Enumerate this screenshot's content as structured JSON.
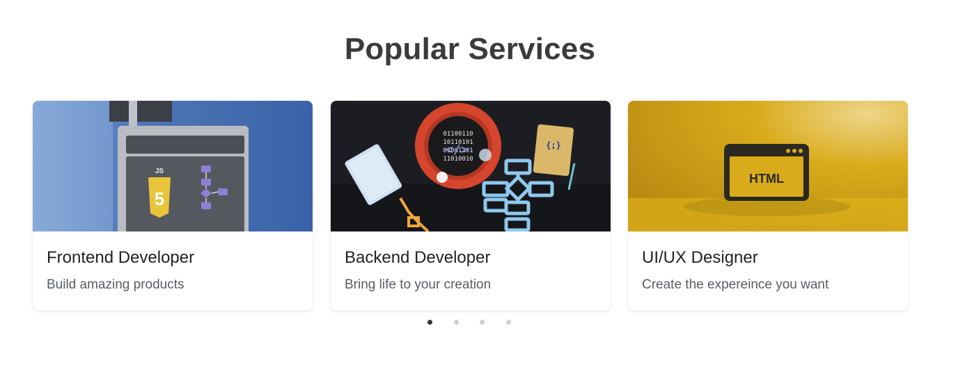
{
  "section": {
    "title": "Popular Services"
  },
  "cards": [
    {
      "title": "Frontend Developer",
      "subtitle": "Build amazing products",
      "image": "javascript-code-window-illustration"
    },
    {
      "title": "Backend Developer",
      "subtitle": "Bring life to your creation",
      "image": "backend-code-flowchart-illustration"
    },
    {
      "title": "UI/UX Designer",
      "subtitle": "Create the expereince you want",
      "image": "html-window-illustration",
      "image_text": "HTML"
    }
  ],
  "carousel": {
    "pages": 4,
    "active_index": 0
  },
  "colors": {
    "title": "#3a3a3f",
    "card_title": "#1f2024",
    "card_subtitle": "#585c63",
    "dot_active": "#333333",
    "dot_inactive": "#cfcfcf"
  }
}
